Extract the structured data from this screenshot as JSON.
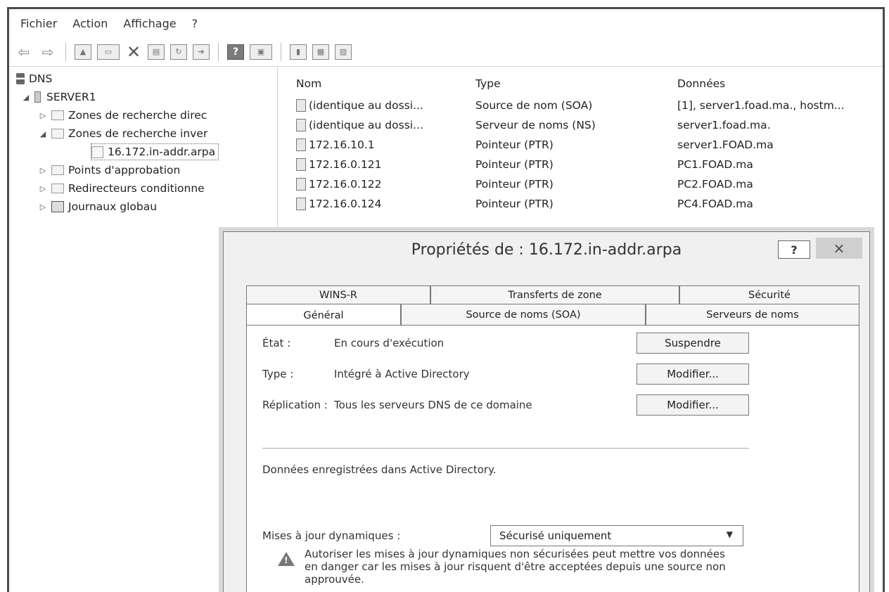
{
  "menu": [
    "Fichier",
    "Action",
    "Affichage",
    "?"
  ],
  "tree": {
    "root": "DNS",
    "server": "SERVER1",
    "items": [
      "Zones de recherche direc",
      "Zones de recherche inver",
      "16.172.in-addr.arpa",
      "Points d'approbation",
      "Redirecteurs conditionne",
      "Journaux globau"
    ]
  },
  "list": {
    "headers": {
      "name": "Nom",
      "type": "Type",
      "data": "Données"
    },
    "rows": [
      {
        "name": "(identique au dossi...",
        "type": "Source de nom (SOA)",
        "data": "[1], server1.foad.ma., hostm..."
      },
      {
        "name": "(identique au dossi...",
        "type": "Serveur de noms (NS)",
        "data": "server1.foad.ma."
      },
      {
        "name": "172.16.10.1",
        "type": "Pointeur (PTR)",
        "data": "server1.FOAD.ma"
      },
      {
        "name": "172.16.0.121",
        "type": "Pointeur (PTR)",
        "data": "PC1.FOAD.ma"
      },
      {
        "name": "172.16.0.122",
        "type": "Pointeur (PTR)",
        "data": "PC2.FOAD.ma"
      },
      {
        "name": "172.16.0.124",
        "type": "Pointeur (PTR)",
        "data": "PC4.FOAD.ma"
      }
    ]
  },
  "dialog": {
    "title": "Propriétés de : 16.172.in-addr.arpa",
    "help": "?",
    "close": "×",
    "tabs_back": [
      "WINS-R",
      "Transferts de zone",
      "Sécurité"
    ],
    "tabs_front": [
      "Général",
      "Source de noms (SOA)",
      "Serveurs de noms"
    ],
    "state_label": "État :",
    "state_value": "En cours d'exécution",
    "suspend_button": "Suspendre",
    "type_label": "Type :",
    "type_value": "Intégré à Active Directory",
    "modify_button": "Modifier...",
    "replication_label": "Réplication :",
    "replication_value": "Tous les serveurs DNS de ce domaine",
    "stored_text": "Données enregistrées dans Active Directory.",
    "dynamic_label": "Mises à jour dynamiques :",
    "dynamic_value": "Sécurisé uniquement",
    "warning_text": "Autoriser les mises à jour dynamiques non sécurisées peut mettre vos données en danger car les mises à jour risquent d'être acceptées depuis une source non approuvée."
  }
}
